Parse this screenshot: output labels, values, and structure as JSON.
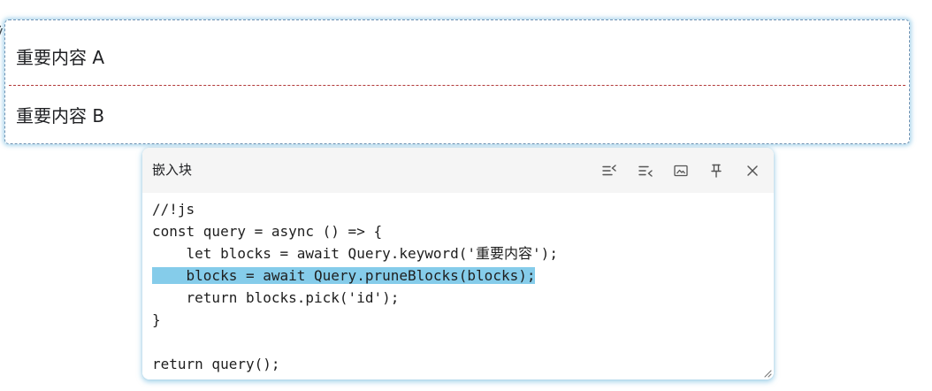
{
  "glyph_fragment": "ÿ",
  "embed_results": [
    {
      "text": "重要内容 A"
    },
    {
      "text": "重要内容 B"
    }
  ],
  "popover": {
    "title": "嵌入块",
    "toolbar": [
      {
        "name": "sort-icon"
      },
      {
        "name": "collapse-list-icon"
      },
      {
        "name": "image-icon"
      },
      {
        "name": "pin-icon"
      },
      {
        "name": "close-icon"
      }
    ],
    "code_lines": [
      "//!js",
      "const query = async () => {",
      "    let blocks = await Query.keyword('重要内容');",
      "    blocks = await Query.pruneBlocks(blocks);",
      "    return blocks.pick('id');",
      "}",
      "",
      "return query();"
    ],
    "selected_line": 4
  },
  "colors": {
    "selection": "#85ccea",
    "divider": "#b23a3a",
    "card_glow": "#70b8de",
    "header_bg": "#f5f5f5"
  }
}
